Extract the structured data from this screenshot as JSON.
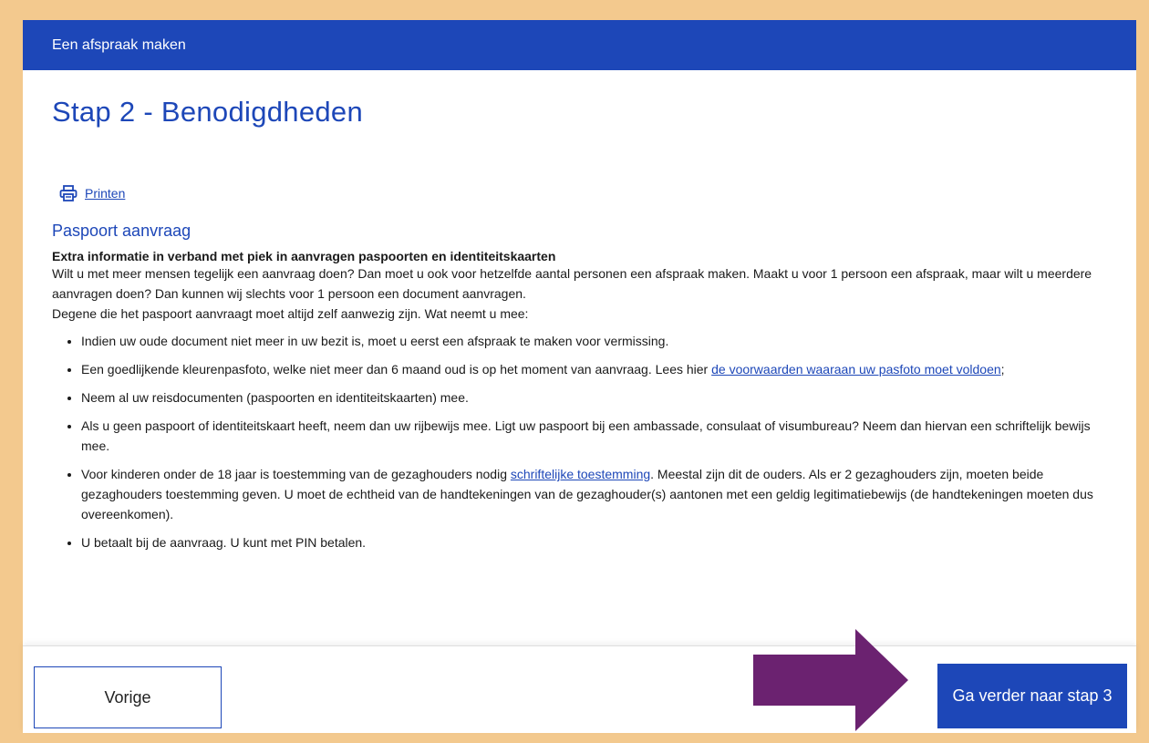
{
  "header": {
    "title": "Een afspraak maken"
  },
  "page": {
    "title": "Stap 2 - Benodigdheden"
  },
  "print": {
    "label": "Printen",
    "icon": "printer-icon"
  },
  "section": {
    "title": "Paspoort aanvraag",
    "extra_title": "Extra informatie in verband met piek in aanvragen paspoorten en identiteitskaarten",
    "intro_1": "Wilt u met meer mensen tegelijk een aanvraag doen? Dan moet u ook voor hetzelfde aantal personen een afspraak maken. Maakt u voor 1 persoon een afspraak, maar wilt u meerdere aanvragen doen? Dan kunnen wij slechts voor 1 persoon een document aanvragen.",
    "intro_2": "Degene die het paspoort aanvraagt moet altijd zelf aanwezig zijn. Wat neemt u mee:",
    "items": [
      {
        "text": "Indien uw oude document niet meer in uw bezit is, moet u eerst een afspraak te maken voor vermissing."
      },
      {
        "text_before": "Een goedlijkende kleurenpasfoto, welke niet meer dan 6 maand oud is op het moment van aanvraag. Lees hier ",
        "link": "de voorwaarden waaraan uw pasfoto moet voldoen",
        "text_after": ";"
      },
      {
        "text": "Neem al uw reisdocumenten (paspoorten en identiteitskaarten) mee."
      },
      {
        "text": "Als u geen paspoort of identiteitskaart heeft, neem dan uw rijbewijs mee. Ligt uw paspoort bij een ambassade, consulaat of visumbureau? Neem dan hiervan een schriftelijk bewijs mee."
      },
      {
        "text_before": "Voor kinderen onder de 18 jaar is toestemming van de gezaghouders nodig ",
        "link": "schriftelijke toestemming",
        "text_after": ". Meestal zijn dit de ouders. Als er 2 gezaghouders zijn, moeten beide gezaghouders toestemming geven. U moet de echtheid van de handtekeningen van de gezaghouder(s) aantonen met een geldig legitimatiebewijs (de handtekeningen moeten dus overeenkomen)."
      },
      {
        "text": "U betaalt bij de aanvraag. U kunt met PIN betalen."
      }
    ]
  },
  "footer": {
    "prev_label": "Vorige",
    "next_label": "Ga verder naar stap 3"
  },
  "colors": {
    "brand_blue": "#1d47b8",
    "background": "#f3c98e",
    "annotation_arrow": "#6b2270"
  }
}
